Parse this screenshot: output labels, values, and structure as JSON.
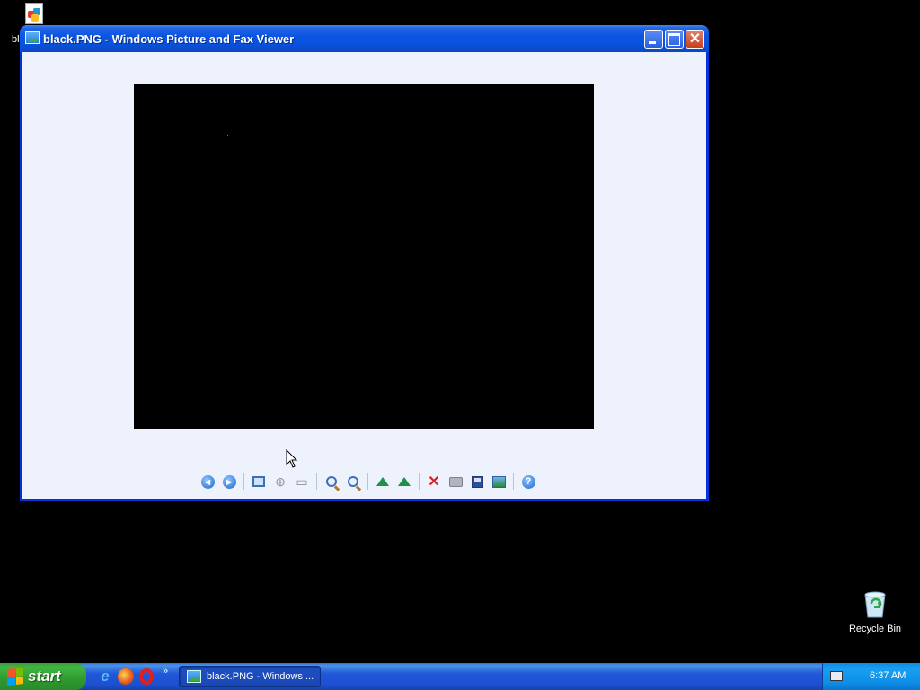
{
  "desktop": {
    "top_icon_label": "bl",
    "recycle_bin_label": "Recycle Bin"
  },
  "window": {
    "title": "black.PNG - Windows Picture and Fax Viewer",
    "image_color": "#000000"
  },
  "toolbar": {
    "buttons": [
      "previous-image-icon",
      "next-image-icon",
      "best-fit-icon",
      "actual-size-icon",
      "slideshow-icon",
      "zoom-in-icon",
      "zoom-out-icon",
      "rotate-clockwise-icon",
      "rotate-counterclockwise-icon",
      "delete-icon",
      "print-icon",
      "save-icon",
      "open-for-editing-icon",
      "help-icon"
    ]
  },
  "taskbar": {
    "start_label": "start",
    "overflow_glyph": "»",
    "task_label": "black.PNG - Windows ...",
    "clock": "6:37 AM"
  }
}
